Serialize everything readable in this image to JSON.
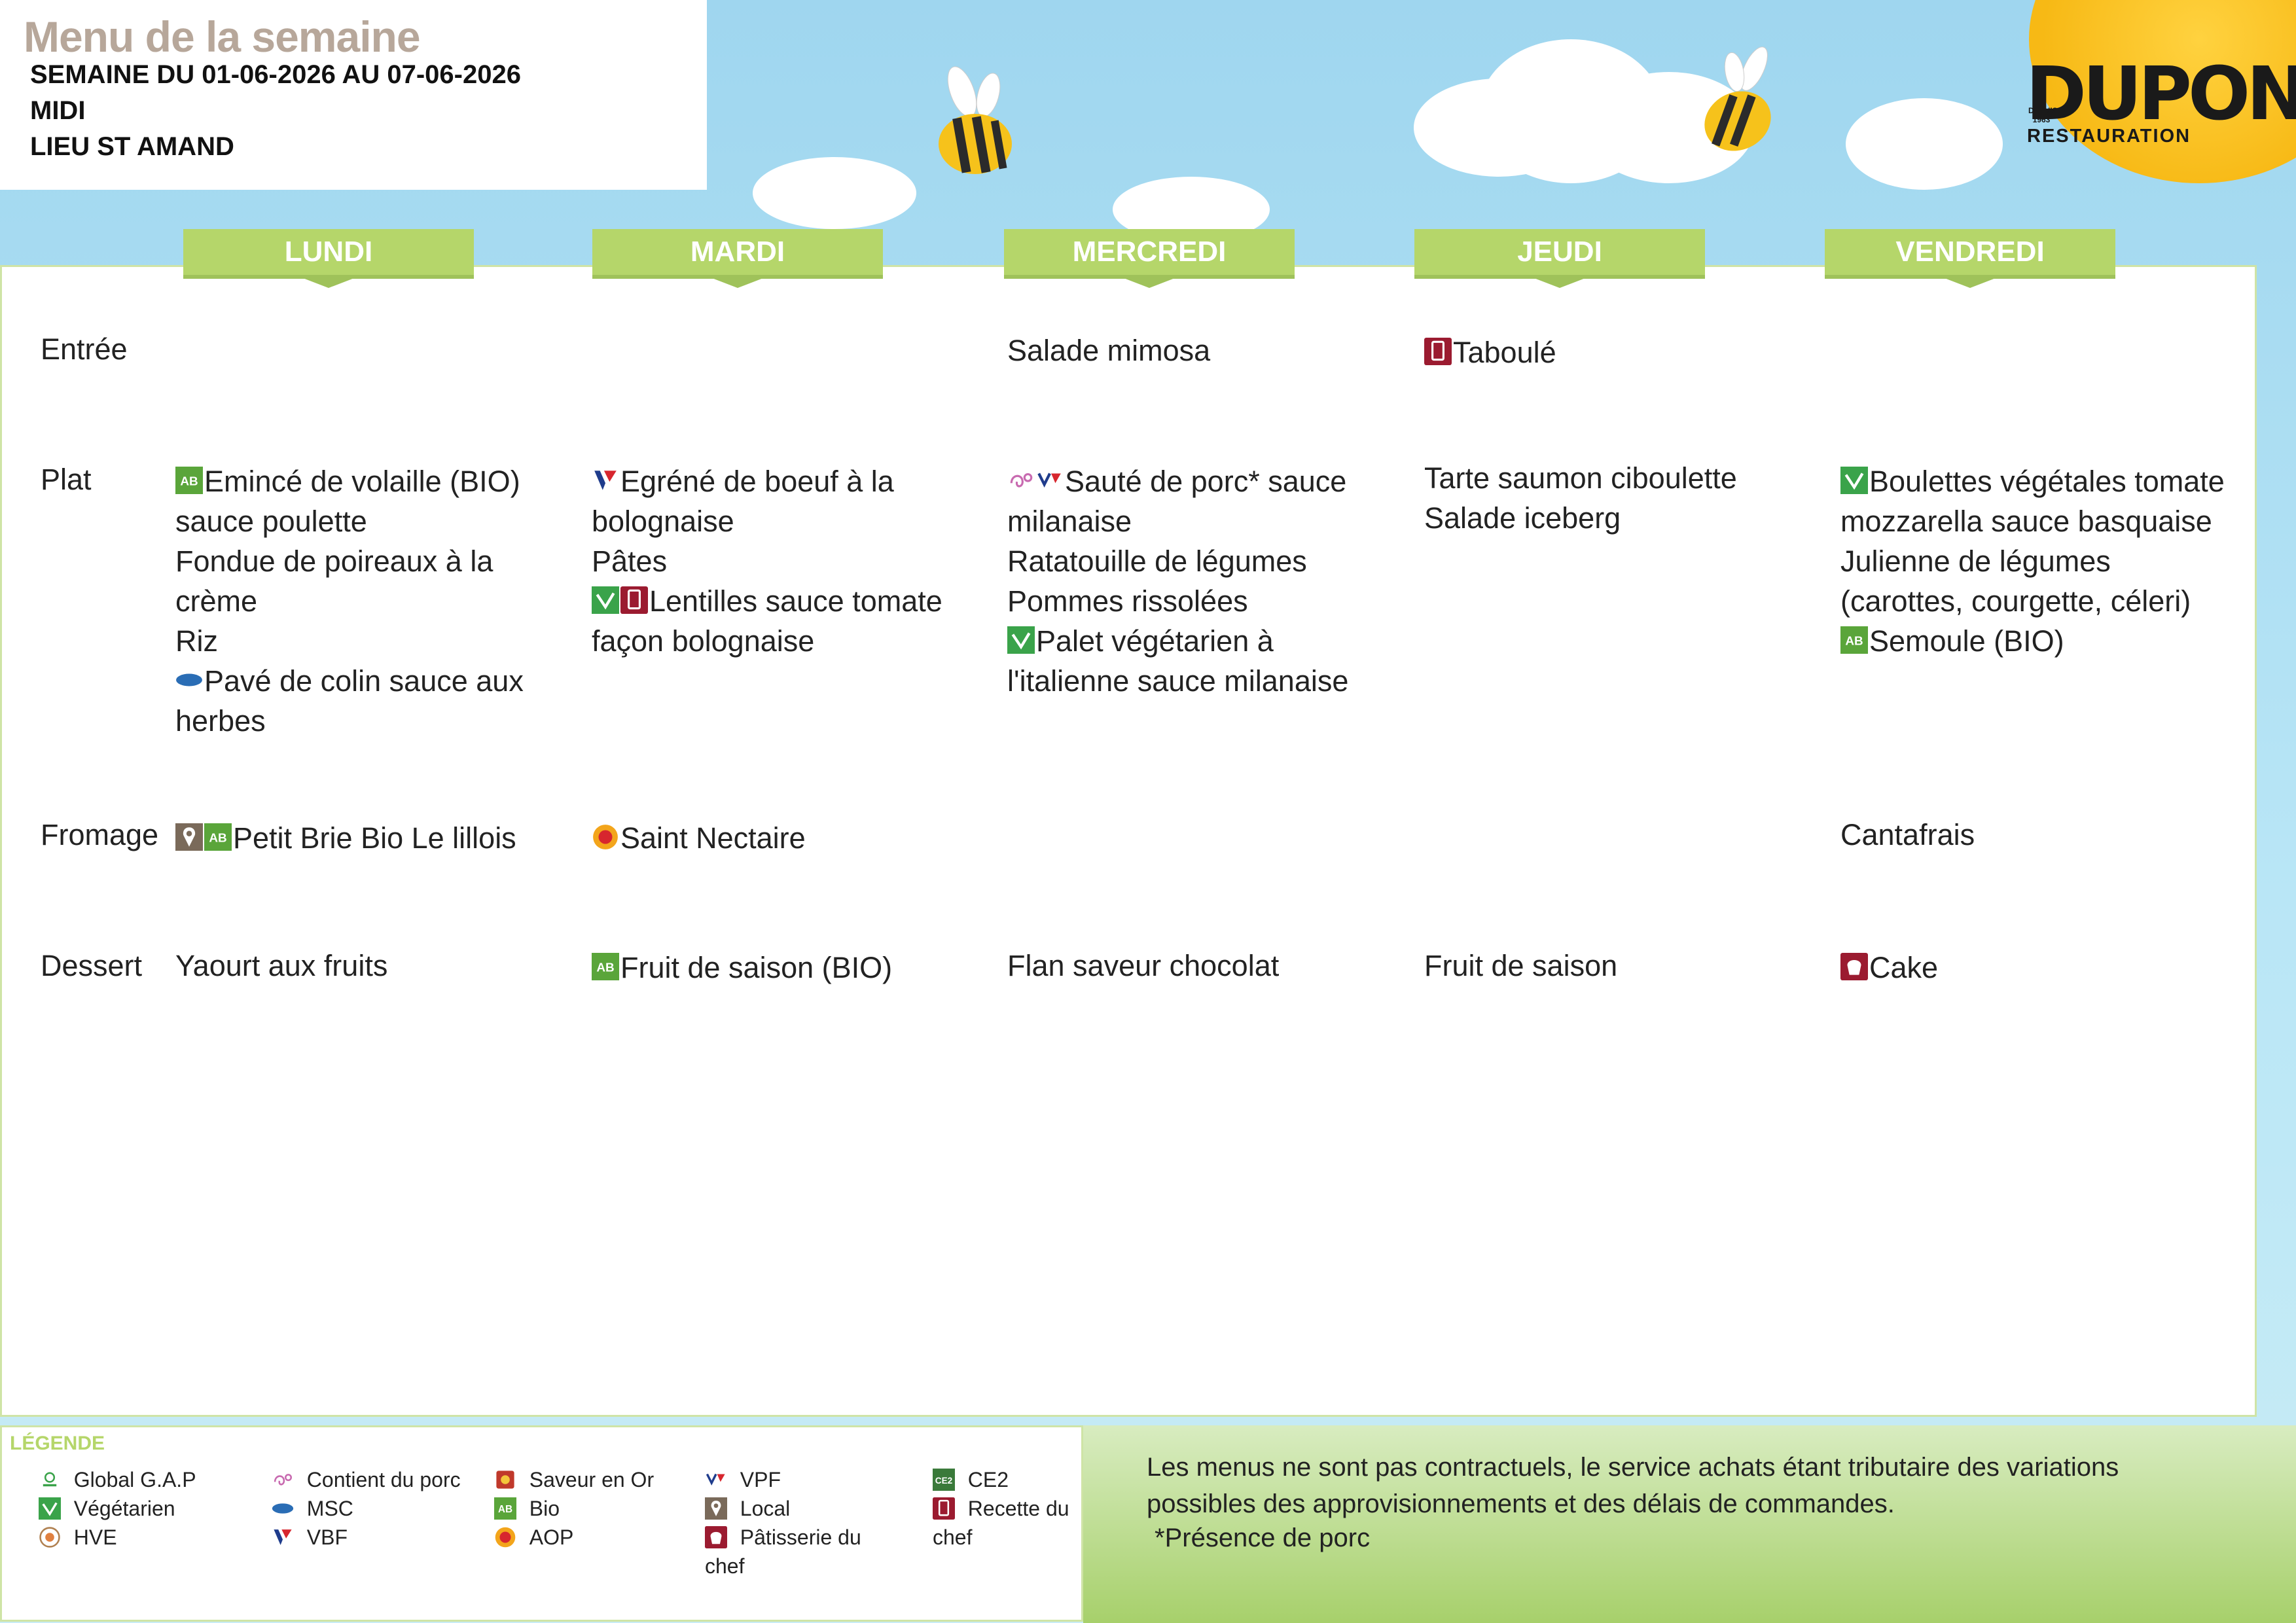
{
  "header": {
    "title": "Menu de la semaine",
    "week": "SEMAINE DU 01-06-2026 AU 07-06-2026",
    "service": "MIDI",
    "place": "LIEU ST AMAND"
  },
  "logo": {
    "main": "DUPONT",
    "since": "DEPUIS 1963",
    "sub": "RESTAURATION"
  },
  "days": [
    "LUNDI",
    "MARDI",
    "MERCREDI",
    "JEUDI",
    "VENDREDI"
  ],
  "categories": [
    "Entrée",
    "Plat",
    "Fromage",
    "Dessert"
  ],
  "menu": {
    "entree": {
      "mercredi": "Salade mimosa",
      "jeudi": "Taboulé"
    },
    "plat": {
      "lundi": [
        "Emincé de volaille (BIO)",
        "sauce poulette",
        "Fondue de poireaux à la",
        "crème",
        "Riz",
        "Pavé de colin sauce aux",
        "herbes"
      ],
      "mardi": [
        "Egréné de boeuf à la",
        "bolognaise",
        "Pâtes",
        "Lentilles sauce tomate",
        "façon bolognaise"
      ],
      "mercredi": [
        "Sauté de porc* sauce",
        "milanaise",
        "Ratatouille de légumes",
        "Pommes rissolées",
        "Palet végétarien à",
        "l'italienne sauce milanaise"
      ],
      "jeudi": [
        "Tarte saumon ciboulette",
        "Salade iceberg"
      ],
      "vendredi": [
        "Boulettes végétales tomate",
        "mozzarella sauce basquaise",
        "Julienne de légumes",
        "(carottes, courgette, céleri)",
        "Semoule (BIO)"
      ]
    },
    "fromage": {
      "lundi": "Petit Brie Bio Le lillois",
      "mardi": "Saint Nectaire",
      "vendredi": "Cantafrais"
    },
    "dessert": {
      "lundi": "Yaourt aux fruits",
      "mardi": "Fruit de saison (BIO)",
      "mercredi": "Flan saveur chocolat",
      "jeudi": "Fruit de saison",
      "vendredi": "Cake"
    }
  },
  "legend": {
    "title": "LÉGENDE",
    "items": [
      {
        "label": "Global G.A.P",
        "icon": "globalgap-icon"
      },
      {
        "label": "Végétarien",
        "icon": "vegetarian-icon"
      },
      {
        "label": "HVE",
        "icon": "hve-icon"
      },
      {
        "label": "Contient du porc",
        "icon": "pork-icon"
      },
      {
        "label": "MSC",
        "icon": "msc-icon"
      },
      {
        "label": "VBF",
        "icon": "vbf-icon"
      },
      {
        "label": "Saveur en Or",
        "icon": "saveur-en-or-icon"
      },
      {
        "label": "Bio",
        "icon": "bio-icon"
      },
      {
        "label": "AOP",
        "icon": "aop-icon"
      },
      {
        "label": "VPF",
        "icon": "vpf-icon"
      },
      {
        "label": "Local",
        "icon": "local-icon"
      },
      {
        "label": "Pâtisserie du chef",
        "icon": "patisserie-icon"
      },
      {
        "label": "CE2",
        "icon": "ce2-icon"
      },
      {
        "label": "Recette du chef",
        "icon": "recette-chef-icon"
      }
    ]
  },
  "disclaimer": {
    "text": "Les menus ne sont pas contractuels, le service achats étant tributaire des variations possibles des approvisionnements et des délais de commandes.",
    "note": "*Présence de porc"
  },
  "colors": {
    "accent_green": "#b5d66a",
    "title_grey": "#b7a79a",
    "sky_blue": "#aee0f3",
    "sun_yellow": "#f7b915"
  }
}
